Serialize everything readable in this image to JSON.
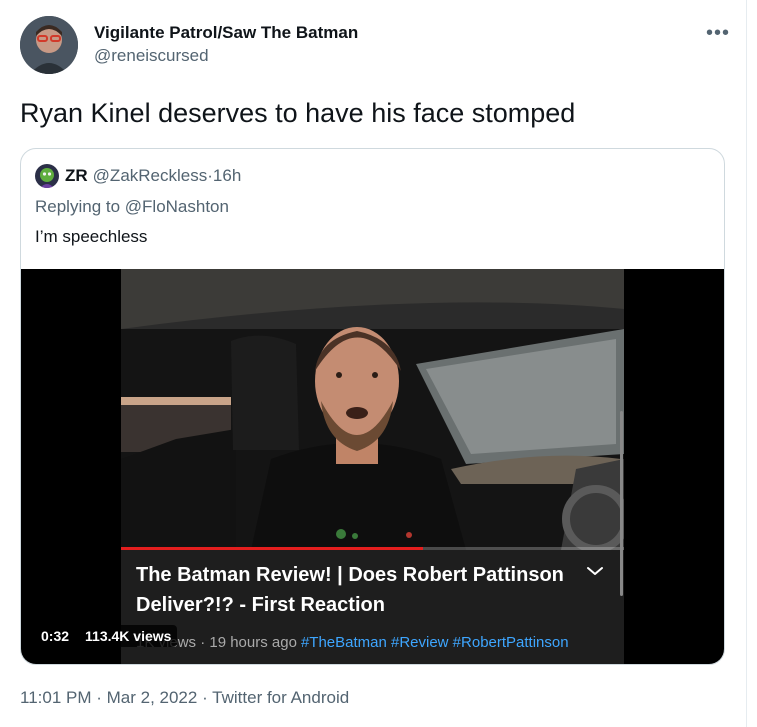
{
  "tweet": {
    "display_name": "Vigilante Patrol/Saw The Batman",
    "handle": "@reneiscursed",
    "more_label": "•••",
    "text": "Ryan Kinel deserves to have his face stomped",
    "footer": {
      "time": "11:01 PM",
      "separator": " · ",
      "date": "Mar 2, 2022",
      "source": "Twitter for Android"
    }
  },
  "quote": {
    "name": "ZR",
    "handle": "@ZakReckless",
    "dot": " · ",
    "age": "16h",
    "replying": "Replying to @FloNashton",
    "text": "I’m speechless",
    "video": {
      "title": "The Batman Review! | Does Robert Pattinson Deliver?!? - First Reaction",
      "meta_prefix": "1K views",
      "meta_age": " · 19 hours ago",
      "tags": "#TheBatman #Review #RobertPattinson",
      "timestamp": "0:32",
      "views": "113.4K views",
      "progress_fraction": 0.6
    }
  },
  "colors": {
    "link": "#3ea6ff",
    "progress": "#e41e1e",
    "muted": "#536471"
  }
}
